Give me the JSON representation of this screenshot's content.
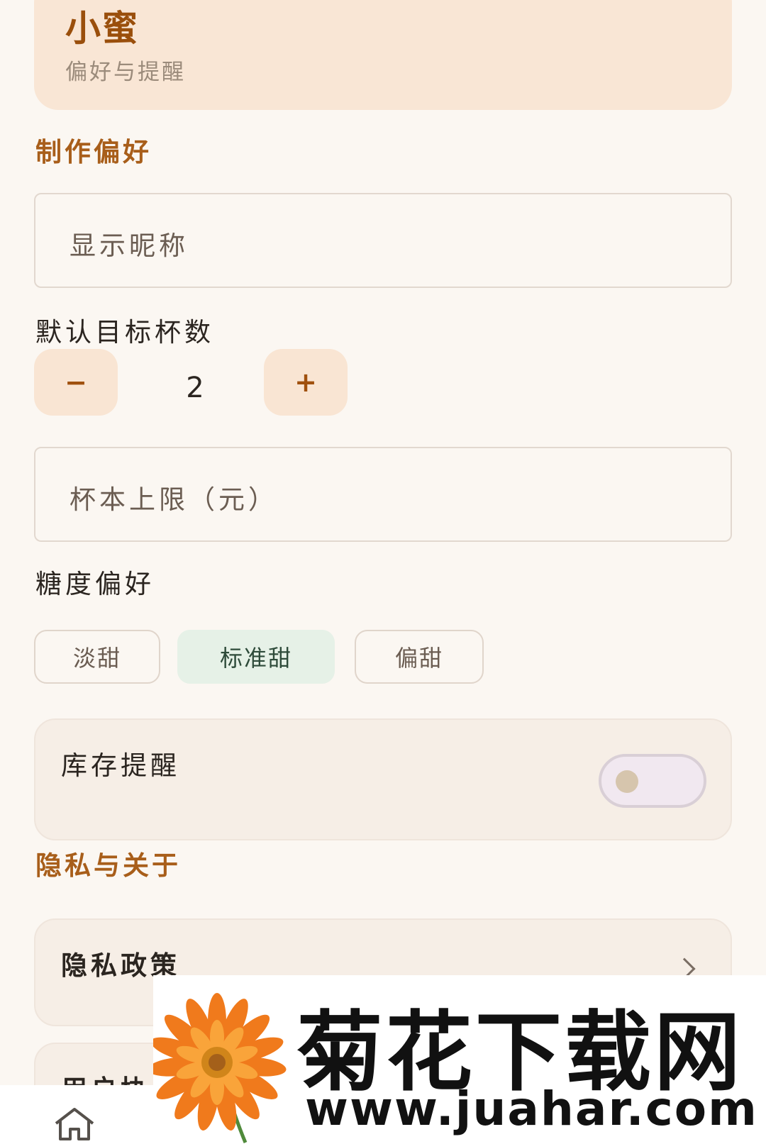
{
  "header": {
    "name": "小蜜",
    "subtitle": "偏好与提醒"
  },
  "sections": {
    "preferences_title": "制作偏好",
    "privacy_title": "隐私与关于"
  },
  "fields": {
    "nickname_placeholder": "显示昵称",
    "cost_limit_placeholder": "杯本上限（元）"
  },
  "cups": {
    "label": "默认目标杯数",
    "minus_label": "−",
    "plus_label": "+",
    "value": "2"
  },
  "sweetness": {
    "label": "糖度偏好",
    "options": [
      "淡甜",
      "标准甜",
      "偏甜"
    ],
    "selected": "标准甜"
  },
  "stock_reminder": {
    "label": "库存提醒",
    "enabled": false
  },
  "links": {
    "privacy_policy": "隐私政策",
    "user_agreement_partial": "用户协"
  },
  "bottom_nav": {
    "home_icon": "home-icon"
  },
  "watermark": {
    "title": "菊花下载网",
    "url": "www.juahar.com"
  },
  "colors": {
    "accent": "#a85e1a",
    "header_bg": "#f9e6d5",
    "chip_selected_bg": "#e6f1e7"
  }
}
